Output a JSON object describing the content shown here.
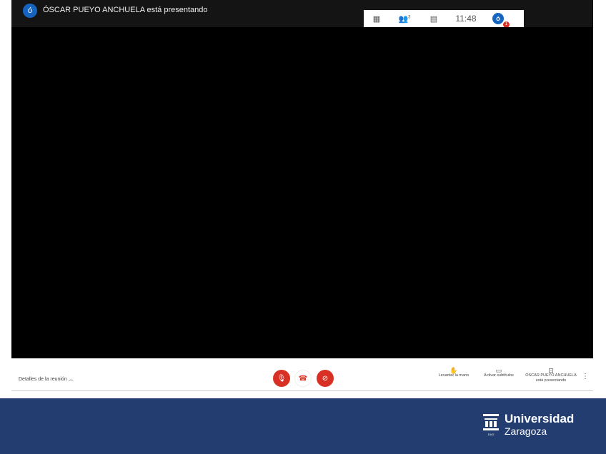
{
  "header": {
    "avatar_letter": "ó",
    "presenter_text": "ÓSCAR PUEYO ANCHUELA está presentando"
  },
  "toolbox": {
    "time": "11:48",
    "people_count": "3",
    "avatar_letter": "ó",
    "notification": "1"
  },
  "controls": {
    "details_label": "Detalles de la reunión",
    "raise_hand": "Levantar la mano",
    "captions": "Activar subtítulos",
    "presenting_line1": "ÓSCAR PUEYO ANCHUELA",
    "presenting_line2": "está presentando"
  },
  "brand": {
    "name": "Universidad",
    "city": "Zaragoza",
    "year": "1542",
    "color": "#233d70"
  }
}
